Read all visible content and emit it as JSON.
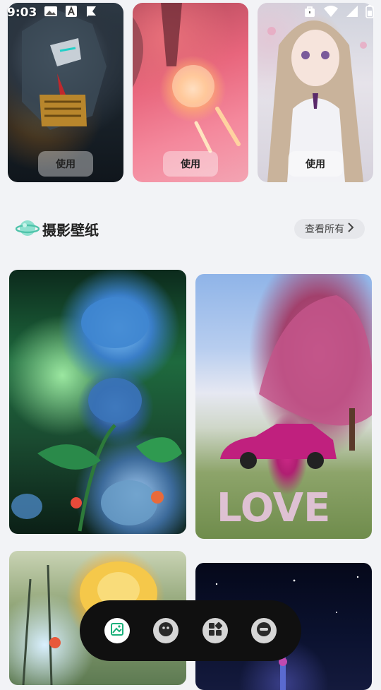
{
  "status_bar": {
    "time": "9:03",
    "left_icons": [
      "gallery-icon",
      "font-icon",
      "flag-icon"
    ],
    "right_icons": [
      "bag-icon",
      "wifi-icon",
      "signal-icon",
      "battery-icon"
    ]
  },
  "top_cards": [
    {
      "name": "mecha-wallpaper",
      "use_label": "使用"
    },
    {
      "name": "pink-tower-wallpaper",
      "use_label": "使用"
    },
    {
      "name": "anime-girl-wallpaper",
      "use_label": "使用"
    }
  ],
  "section": {
    "icon": "planet-icon",
    "title": "摄影壁纸",
    "view_all_label": "查看所有"
  },
  "wallpapers": [
    {
      "name": "blue-peony-wallpaper"
    },
    {
      "name": "pink-car-love-wallpaper"
    },
    {
      "name": "golden-rose-wallpaper"
    },
    {
      "name": "night-sky-tower-wallpaper"
    }
  ],
  "bottom_nav": {
    "items": [
      {
        "icon": "wallpaper-icon",
        "active": true
      },
      {
        "icon": "face-icon",
        "active": false
      },
      {
        "icon": "widgets-icon",
        "active": false
      },
      {
        "icon": "theme-icon",
        "active": false
      }
    ]
  },
  "colors": {
    "background": "#f2f3f6",
    "nav_background": "#101010",
    "planet_accent": "#7fd8c4"
  }
}
